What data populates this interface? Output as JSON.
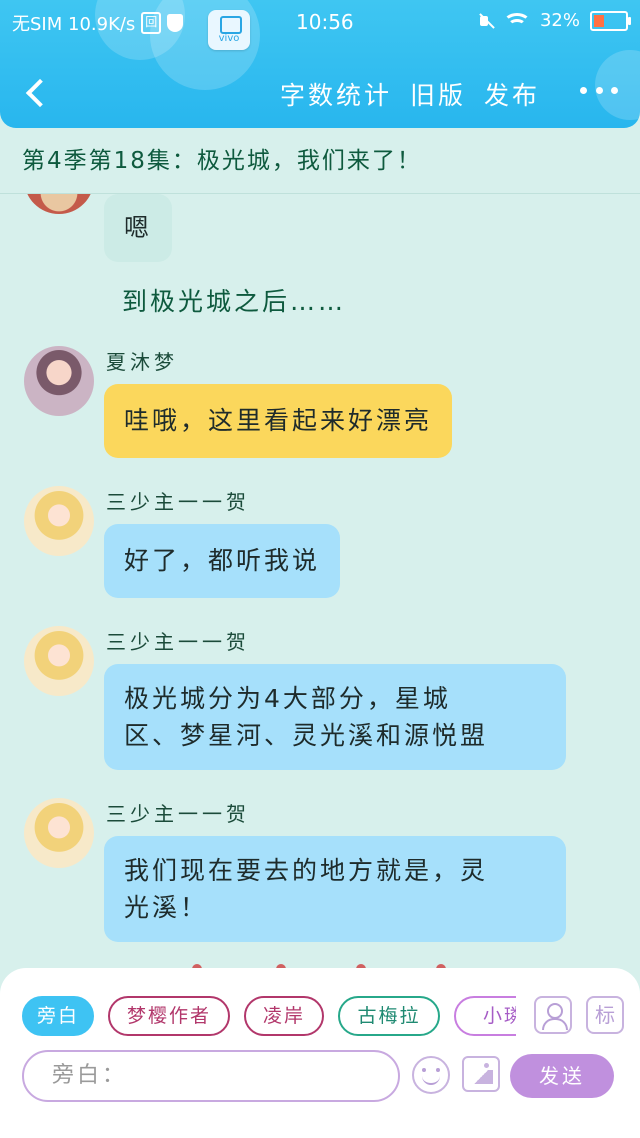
{
  "status_bar": {
    "carrier": "无SIM 10.9K/s",
    "sim_icon_text": "回",
    "app_icon_label": "vivo",
    "time": "10:56",
    "battery_percent": "32%",
    "icons": [
      "sim-icon",
      "shield-icon",
      "vivo-app-icon",
      "mute-icon",
      "wifi-icon",
      "battery-icon"
    ]
  },
  "nav": {
    "word_count_label": "字数统计",
    "old_version_label": "旧版",
    "publish_label": "发布",
    "icons": [
      "back-icon",
      "more-icon"
    ]
  },
  "episode_title": "第4季第18集：极光城，我们来了！",
  "messages": [
    {
      "type": "bubble",
      "style": "gray",
      "text": "嗯"
    },
    {
      "type": "narration",
      "text": "到极光城之后……"
    },
    {
      "type": "bubble",
      "style": "yellow",
      "speaker": "夏沐梦",
      "text": "哇哦，这里看起来好漂亮"
    },
    {
      "type": "bubble",
      "style": "blue",
      "speaker": "三少主一一贺",
      "text": "好了，都听我说"
    },
    {
      "type": "bubble",
      "style": "blue",
      "speaker": "三少主一一贺",
      "lines": [
        "极光城分为4大部分，星城",
        "区、梦星河、灵光溪和源悦盟"
      ]
    },
    {
      "type": "bubble",
      "style": "blue",
      "speaker": "三少主一一贺",
      "lines": [
        "我们现在要去的地方就是，灵",
        "光溪！"
      ]
    }
  ],
  "composer": {
    "roles": [
      "旁白",
      "梦樱作者",
      "凌岸",
      "古梅拉",
      "小璘"
    ],
    "selected_role": "旁白",
    "marker_button": "标",
    "input_placeholder": "旁白：",
    "send_label": "发送",
    "icons": [
      "character-icon",
      "emoji-icon",
      "image-icon"
    ]
  },
  "colors": {
    "header": "#28b6ee",
    "background": "#d7f0ec",
    "yellow_bubble": "#fbd75c",
    "blue_bubble": "#a6e0fb",
    "send_button": "#c090de"
  }
}
